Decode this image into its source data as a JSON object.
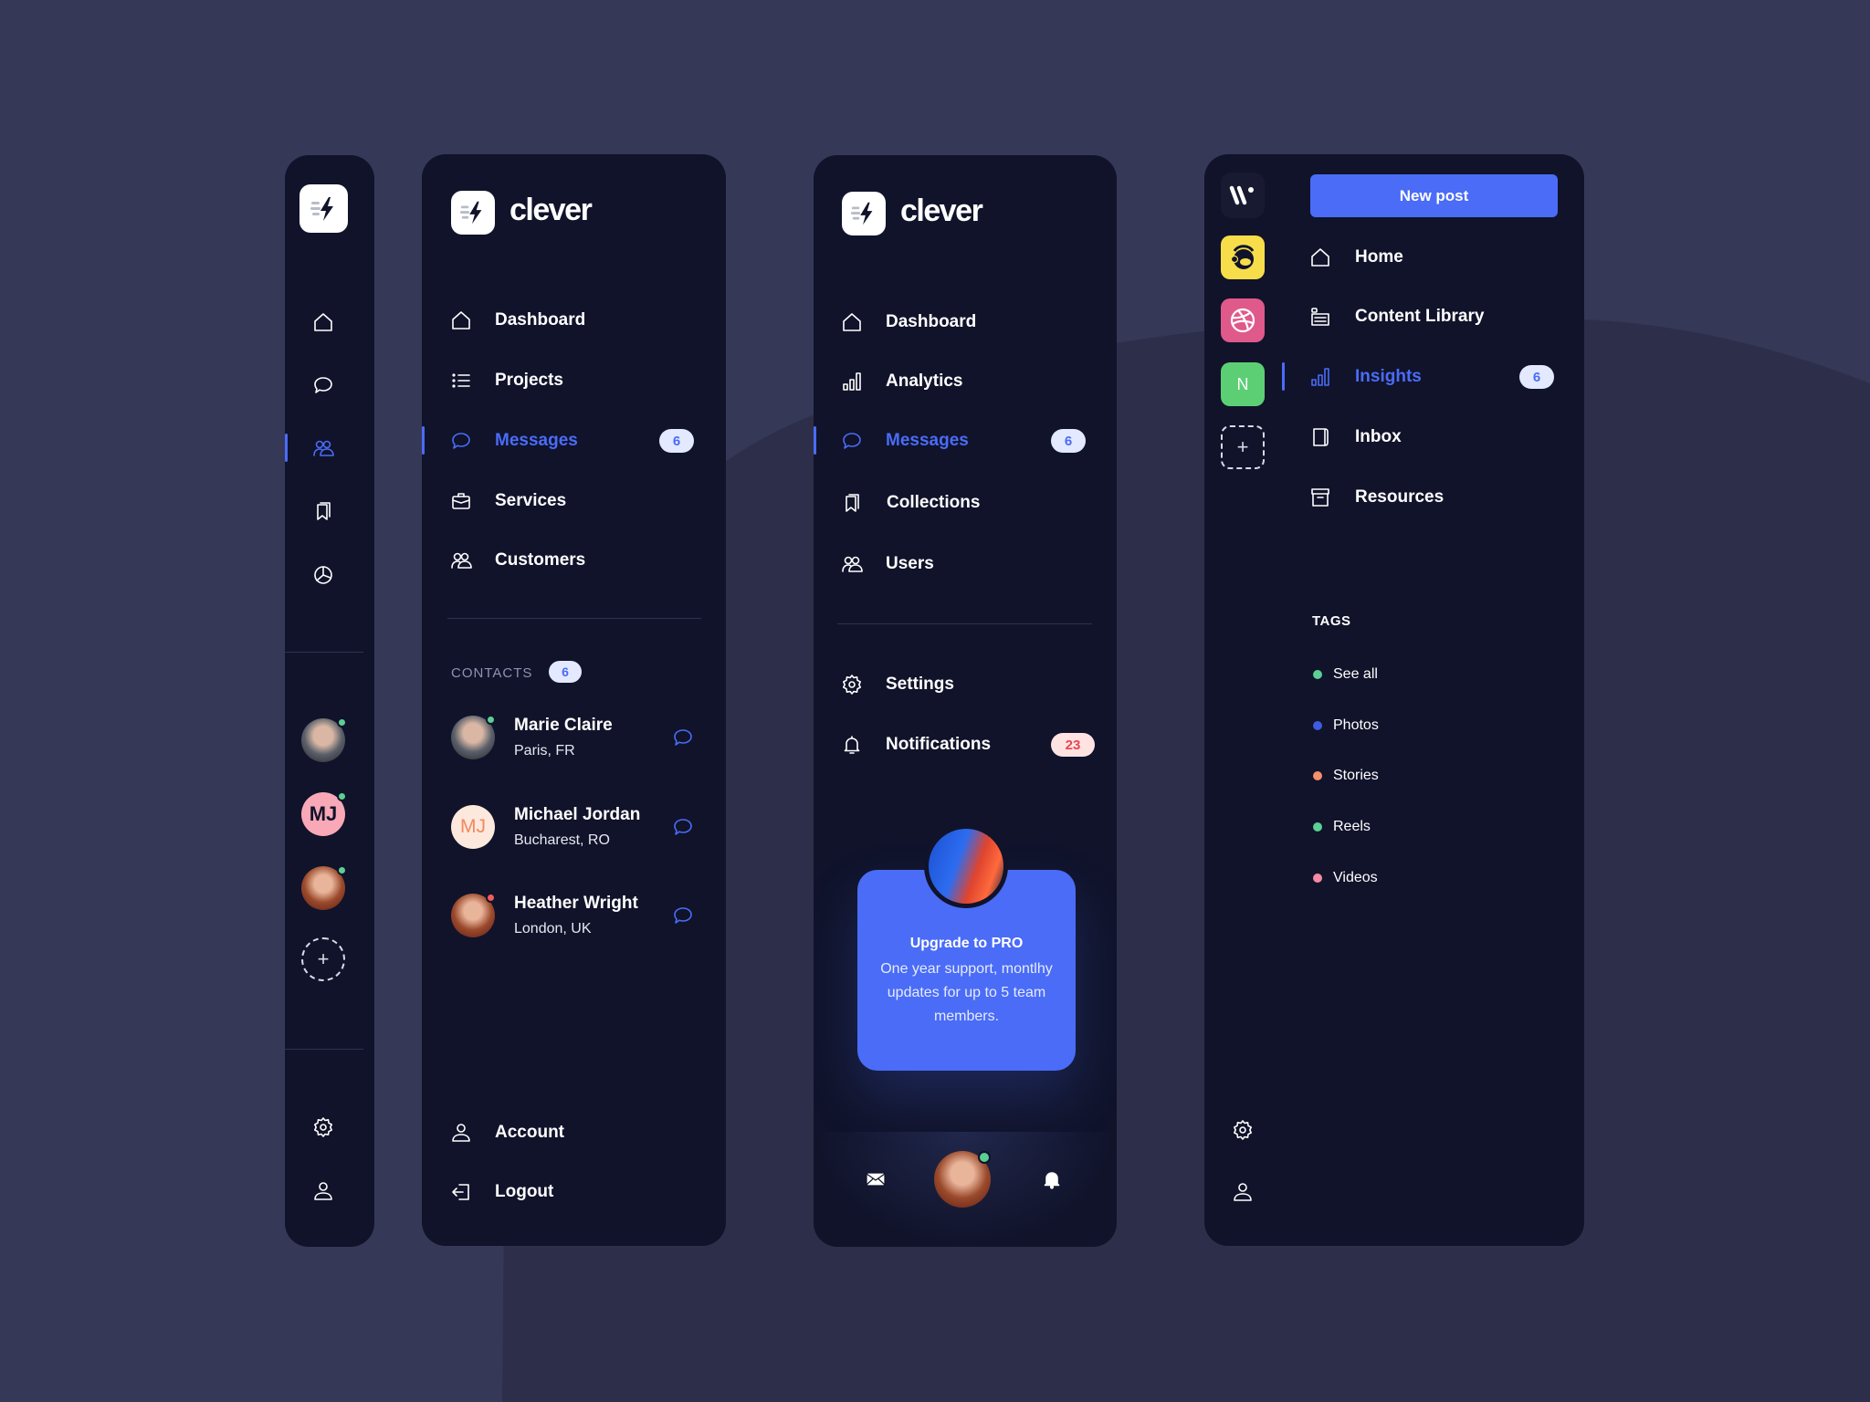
{
  "colors": {
    "accent": "#4a6cf7",
    "panel_bg": "#10132a",
    "page_bg": "#363857",
    "page_blob": "#2d2f4a",
    "badge_bg": "#e3e9ff",
    "badge_red_bg": "#ffe3e3",
    "badge_red_text": "#e5484d",
    "status_online": "#5ccf95",
    "status_busy": "#f25c5c"
  },
  "panel_compact": {
    "logo": "clever-bolt-logo",
    "nav": [
      {
        "icon": "home-icon",
        "active": false
      },
      {
        "icon": "message-icon",
        "active": false
      },
      {
        "icon": "users-icon",
        "active": true
      },
      {
        "icon": "bookmarks-icon",
        "active": false
      },
      {
        "icon": "pie-chart-icon",
        "active": false
      }
    ],
    "avatars": [
      {
        "type": "photo",
        "name": "Marie Claire",
        "status": "online"
      },
      {
        "type": "initials",
        "initials": "MJ",
        "status": "online"
      },
      {
        "type": "photo",
        "name": "Heather Wright",
        "status": "online"
      }
    ],
    "add_label": "+",
    "footer": [
      {
        "icon": "gear-icon"
      },
      {
        "icon": "user-icon"
      }
    ]
  },
  "panel_contacts": {
    "brand": "clever",
    "nav": [
      {
        "label": "Dashboard",
        "icon": "home-icon",
        "active": false
      },
      {
        "label": "Projects",
        "icon": "list-icon",
        "active": false
      },
      {
        "label": "Messages",
        "icon": "message-icon",
        "active": true,
        "badge": "6"
      },
      {
        "label": "Services",
        "icon": "briefcase-icon",
        "active": false
      },
      {
        "label": "Customers",
        "icon": "users-icon",
        "active": false
      }
    ],
    "contacts_title": "CONTACTS",
    "contacts_count": "6",
    "contacts": [
      {
        "name": "Marie Claire",
        "location": "Paris, FR",
        "status": "online",
        "avatar": "photo"
      },
      {
        "name": "Michael Jordan",
        "location": "Bucharest, RO",
        "initials": "MJ",
        "avatar": "initials"
      },
      {
        "name": "Heather Wright",
        "location": "London, UK",
        "status": "busy",
        "avatar": "photo"
      }
    ],
    "footer": [
      {
        "label": "Account",
        "icon": "user-icon"
      },
      {
        "label": "Logout",
        "icon": "logout-icon"
      }
    ]
  },
  "panel_upgrade": {
    "brand": "clever",
    "nav": [
      {
        "label": "Dashboard",
        "icon": "home-icon",
        "active": false
      },
      {
        "label": "Analytics",
        "icon": "bar-chart-icon",
        "active": false
      },
      {
        "label": "Messages",
        "icon": "message-icon",
        "active": true,
        "badge": "6"
      },
      {
        "label": "Collections",
        "icon": "bookmarks-icon",
        "active": false
      },
      {
        "label": "Users",
        "icon": "users-icon",
        "active": false
      }
    ],
    "secondary": [
      {
        "label": "Settings",
        "icon": "gear-icon"
      },
      {
        "label": "Notifications",
        "icon": "bell-icon",
        "badge": "23"
      }
    ],
    "upgrade": {
      "title": "Upgrade to PRO",
      "text": "One year support, montlhy updates for up to 5 team members."
    },
    "bottom_bar": [
      {
        "icon": "mail-icon"
      },
      {
        "icon": "avatar",
        "status": "online"
      },
      {
        "icon": "bell-icon"
      }
    ]
  },
  "panel_content": {
    "workspace_logo": "W",
    "apps": [
      {
        "name": "Mailchimp",
        "color": "#f7dd4a"
      },
      {
        "name": "Dribbble",
        "color": "#e0598b"
      },
      {
        "name": "N",
        "color": "#5ccf74",
        "label": "N"
      }
    ],
    "add_app_label": "+",
    "new_post_label": "New post",
    "nav": [
      {
        "label": "Home",
        "icon": "home-icon",
        "active": false
      },
      {
        "label": "Content Library",
        "icon": "content-library-icon",
        "active": false
      },
      {
        "label": "Insights",
        "icon": "bar-chart-icon",
        "active": true,
        "badge": "6"
      },
      {
        "label": "Inbox",
        "icon": "inbox-icon",
        "active": false
      },
      {
        "label": "Resources",
        "icon": "archive-icon",
        "active": false
      }
    ],
    "tags_title": "TAGS",
    "tags": [
      {
        "label": "See all",
        "color": "#5ccf95"
      },
      {
        "label": "Photos",
        "color": "#3f5be0"
      },
      {
        "label": "Stories",
        "color": "#f6906a"
      },
      {
        "label": "Reels",
        "color": "#5ccf95"
      },
      {
        "label": "Videos",
        "color": "#f58aa6"
      }
    ],
    "footer": [
      {
        "icon": "gear-icon"
      },
      {
        "icon": "user-icon"
      }
    ]
  }
}
